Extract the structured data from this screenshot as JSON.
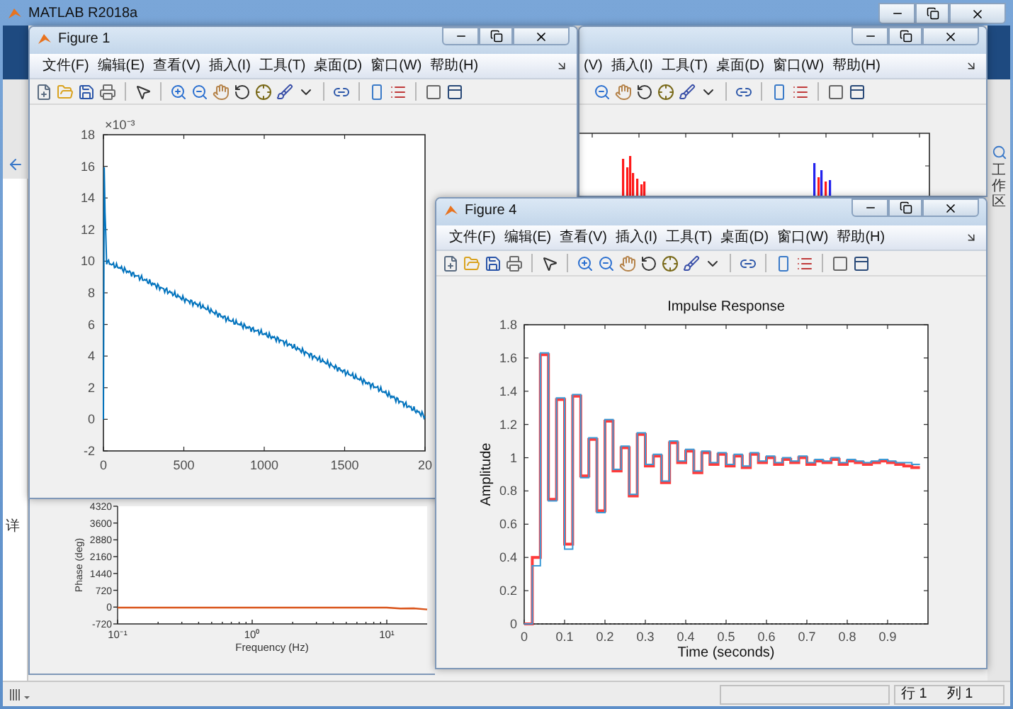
{
  "main_window": {
    "title": "MATLAB R2018a",
    "left_panel_tab": "详",
    "right_panel_tab": "工作区",
    "status_bar": {
      "line_indicator": "行 1",
      "column_indicator": "列 1"
    }
  },
  "figure_1": {
    "title": "Figure 1",
    "menu": [
      "文件(F)",
      "编辑(E)",
      "查看(V)",
      "插入(I)",
      "工具(T)",
      "桌面(D)",
      "窗口(W)",
      "帮助(H)"
    ],
    "y_multiplier": "×10⁻³",
    "cut_tick_label": "20",
    "chart_data": {
      "type": "line",
      "x": [
        0,
        5,
        10,
        20,
        50,
        100,
        200,
        300,
        400,
        500,
        600,
        700,
        800,
        900,
        1000,
        1100,
        1200,
        1300,
        1400,
        1500,
        1600,
        1700,
        1800,
        1900,
        2000
      ],
      "series": [
        {
          "color": "#0072bd",
          "values": [
            0,
            16,
            13,
            10,
            9.8,
            9.6,
            9.1,
            8.6,
            8.1,
            7.6,
            7.2,
            6.7,
            6.2,
            5.8,
            5.4,
            5.0,
            4.5,
            4.0,
            3.5,
            3.0,
            2.5,
            2.0,
            1.4,
            0.8,
            0.2
          ]
        }
      ],
      "xlim": [
        0,
        2000
      ],
      "ylim": [
        -2,
        18
      ],
      "xticks": [
        0,
        500,
        1000,
        1500
      ],
      "yticks": [
        -2,
        0,
        2,
        4,
        6,
        8,
        10,
        12,
        14,
        16,
        18
      ]
    }
  },
  "figure_2": {
    "menu": [
      "(V)",
      "插入(I)",
      "工具(T)",
      "桌面(D)",
      "窗口(W)",
      "帮助(H)"
    ]
  },
  "phase_plot_window": {
    "chart_data": {
      "type": "line",
      "xlabel": "Frequency (Hz)",
      "ylabel": "Phase (deg)",
      "categories": [
        "10⁻¹",
        null,
        null,
        null,
        null,
        null,
        null,
        null,
        null,
        null,
        "10⁰",
        null,
        null,
        null,
        null,
        null,
        null,
        null,
        null,
        null,
        "10¹",
        null,
        null,
        null
      ],
      "series": [
        {
          "color": "#d95319",
          "values": [
            -20,
            -20,
            -20,
            -20,
            -20,
            -20,
            -20,
            -20,
            -20,
            -20,
            -20,
            -20,
            -20,
            -20,
            -20,
            -20,
            -20,
            -20,
            -20,
            -20,
            -20,
            -60,
            -50,
            -100
          ]
        }
      ],
      "ylim": [
        -720,
        4320
      ],
      "yticks": [
        -720,
        0,
        720,
        1440,
        2160,
        2880,
        3600,
        4320
      ]
    }
  },
  "figure_4": {
    "title": "Figure 4",
    "menu": [
      "文件(F)",
      "编辑(E)",
      "查看(V)",
      "插入(I)",
      "工具(T)",
      "桌面(D)",
      "窗口(W)",
      "帮助(H)"
    ],
    "chart_data": {
      "type": "line",
      "title": "Impulse Response",
      "xlabel": "Time (seconds)",
      "ylabel": "Amplitude",
      "x": [
        0,
        0.02,
        0.02,
        0.04,
        0.04,
        0.06,
        0.06,
        0.08,
        0.08,
        0.1,
        0.1,
        0.12,
        0.12,
        0.14,
        0.14,
        0.16,
        0.16,
        0.18,
        0.18,
        0.2,
        0.2,
        0.22,
        0.22,
        0.24,
        0.24,
        0.26,
        0.26,
        0.28,
        0.28,
        0.3,
        0.3,
        0.32,
        0.32,
        0.34,
        0.34,
        0.36,
        0.36,
        0.38,
        0.38,
        0.4,
        0.4,
        0.42,
        0.42,
        0.44,
        0.44,
        0.46,
        0.46,
        0.48,
        0.48,
        0.5,
        0.5,
        0.52,
        0.52,
        0.54,
        0.54,
        0.56,
        0.56,
        0.58,
        0.58,
        0.6,
        0.6,
        0.62,
        0.62,
        0.64,
        0.64,
        0.66,
        0.66,
        0.68,
        0.68,
        0.7,
        0.7,
        0.72,
        0.72,
        0.74,
        0.74,
        0.76,
        0.76,
        0.78,
        0.78,
        0.8,
        0.8,
        0.82,
        0.82,
        0.84,
        0.84,
        0.86,
        0.86,
        0.88,
        0.88,
        0.9,
        0.9,
        0.92,
        0.92,
        0.94,
        0.94,
        0.96,
        0.96,
        0.98
      ],
      "series": [
        {
          "color": "#ff3b3b",
          "values": [
            0,
            0,
            0.4,
            0.4,
            1.62,
            1.62,
            0.75,
            0.75,
            1.35,
            1.35,
            0.48,
            0.48,
            1.37,
            1.37,
            0.89,
            0.89,
            1.11,
            1.11,
            0.68,
            0.68,
            1.22,
            1.22,
            0.92,
            0.92,
            1.06,
            1.06,
            0.77,
            0.77,
            1.14,
            1.14,
            0.95,
            0.95,
            1.01,
            1.01,
            0.85,
            0.85,
            1.09,
            1.09,
            0.97,
            0.97,
            1.04,
            1.04,
            0.91,
            0.91,
            1.03,
            1.03,
            0.96,
            0.96,
            1.02,
            1.02,
            0.95,
            0.95,
            1.01,
            1.01,
            0.94,
            0.94,
            1.02,
            1.02,
            0.97,
            0.97,
            1,
            1,
            0.96,
            0.96,
            0.99,
            0.99,
            0.97,
            0.97,
            1,
            1,
            0.96,
            0.96,
            0.98,
            0.98,
            0.97,
            0.97,
            0.99,
            0.99,
            0.96,
            0.96,
            0.98,
            0.98,
            0.97,
            0.97,
            0.96,
            0.96,
            0.97,
            0.97,
            0.98,
            0.98,
            0.97,
            0.97,
            0.96,
            0.96,
            0.95,
            0.95,
            0.94,
            0.94
          ]
        },
        {
          "color": "#3c9ad6",
          "values": [
            0,
            0,
            0.35,
            0.35,
            1.63,
            1.63,
            0.74,
            0.74,
            1.36,
            1.36,
            0.45,
            0.45,
            1.38,
            1.38,
            0.88,
            0.88,
            1.12,
            1.12,
            0.67,
            0.67,
            1.23,
            1.23,
            0.93,
            0.93,
            1.07,
            1.07,
            0.78,
            0.78,
            1.15,
            1.15,
            0.96,
            0.96,
            1.02,
            1.02,
            0.86,
            0.86,
            1.1,
            1.1,
            0.98,
            0.98,
            1.05,
            1.05,
            0.92,
            0.92,
            1.04,
            1.04,
            0.97,
            0.97,
            1.03,
            1.03,
            0.96,
            0.96,
            1.02,
            1.02,
            0.95,
            0.95,
            1.03,
            1.03,
            0.98,
            0.98,
            1.01,
            1.01,
            0.97,
            0.97,
            1,
            1,
            0.98,
            0.98,
            1.01,
            1.01,
            0.97,
            0.97,
            0.99,
            0.99,
            0.98,
            0.98,
            1,
            1,
            0.97,
            0.97,
            0.99,
            0.99,
            0.98,
            0.98,
            0.97,
            0.97,
            0.98,
            0.98,
            0.99,
            0.99,
            0.98,
            0.98,
            0.97,
            0.97,
            0.97,
            0.97,
            0.96,
            0.96
          ]
        }
      ],
      "xlim": [
        0,
        1
      ],
      "ylim": [
        0,
        1.8
      ],
      "xticks": [
        0,
        0.1,
        0.2,
        0.3,
        0.4,
        0.5,
        0.6,
        0.7,
        0.8,
        0.9
      ],
      "yticks": [
        0,
        0.2,
        0.4,
        0.6,
        0.8,
        1,
        1.2,
        1.4,
        1.6,
        1.8
      ]
    }
  }
}
